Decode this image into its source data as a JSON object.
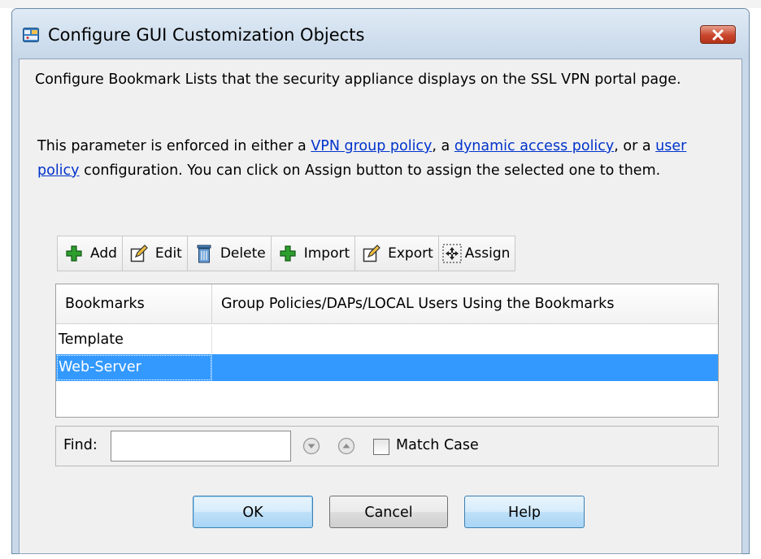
{
  "window": {
    "title": "Configure GUI Customization Objects",
    "close_label": "×"
  },
  "description": {
    "line1": "Configure Bookmark Lists that the security appliance displays on the SSL VPN portal page.",
    "p2_prefix": "This parameter is enforced in either a ",
    "link_vpn_group_policy": "VPN group policy",
    "p2_sep1": ", a ",
    "link_dynamic_access_policy": "dynamic access policy",
    "p2_sep2": ", or a ",
    "link_user_policy": "user policy",
    "p2_suffix": " configuration. You can click on Assign button to assign the selected one to them."
  },
  "toolbar": {
    "add_label": "Add",
    "edit_label": "Edit",
    "delete_label": "Delete",
    "import_label": "Import",
    "export_label": "Export",
    "assign_label": "Assign"
  },
  "table": {
    "columns": [
      "Bookmarks",
      "Group Policies/DAPs/LOCAL Users Using the Bookmarks"
    ],
    "rows": [
      {
        "bookmark": "Template",
        "users": ""
      },
      {
        "bookmark": "Web-Server",
        "users": ""
      }
    ],
    "selected_row": 1
  },
  "find": {
    "label": "Find:",
    "value": "",
    "match_case_label": "Match Case",
    "match_case_checked": false
  },
  "buttons": {
    "ok_label": "OK",
    "cancel_label": "Cancel",
    "help_label": "Help"
  },
  "icons": {
    "app": "asdm-app-icon",
    "add": "green-plus-icon",
    "edit": "edit-pencil-icon",
    "delete": "trash-can-icon",
    "import": "green-plus-icon",
    "export": "edit-pencil-icon",
    "assign": "assign-arrows-icon",
    "find_next": "circle-down-icon",
    "find_prev": "circle-up-icon"
  },
  "colors": {
    "selection": "#3399ff",
    "link": "#0033cc",
    "close_button": "#c9452c",
    "title_bar": "#c9d9ea"
  }
}
